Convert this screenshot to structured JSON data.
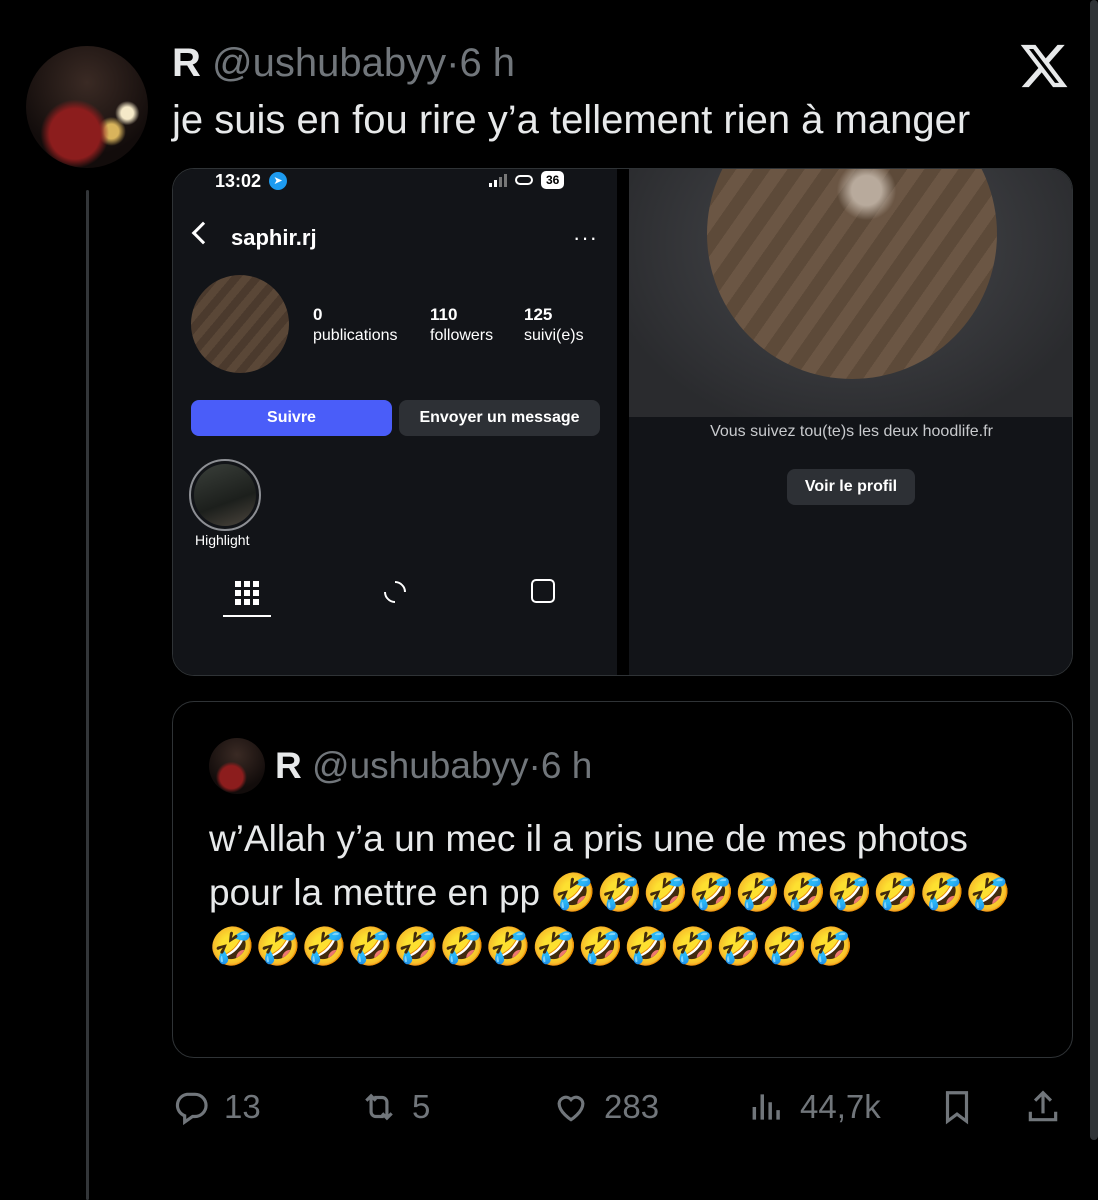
{
  "tweet": {
    "display_name": "R",
    "handle": "@ushubabyy",
    "separator": "·",
    "time": "6 h",
    "text": "je suis en fou rire y’a tellement rien à manger"
  },
  "screenshot_left": {
    "status_time": "13:02",
    "battery": "36",
    "username": "saphir.rj",
    "more": "···",
    "stats": [
      {
        "value": "0",
        "label": "publications"
      },
      {
        "value": "110",
        "label": "followers"
      },
      {
        "value": "125",
        "label": "suivi(e)s"
      }
    ],
    "follow_button": "Suivre",
    "message_button": "Envoyer un message",
    "highlight_label": "Highlight"
  },
  "screenshot_right": {
    "mutual_text": "Vous suivez tou(te)s les deux hoodlife.fr",
    "profile_button": "Voir le profil"
  },
  "quoted_tweet": {
    "display_name": "R",
    "handle": "@ushubabyy",
    "separator": "·",
    "time": "6 h",
    "text": "w’Allah y’a un mec il a pris une de mes photos pour la mettre en pp 🤣🤣🤣🤣🤣🤣🤣🤣🤣🤣🤣🤣🤣🤣🤣🤣🤣🤣🤣🤣🤣🤣🤣🤣"
  },
  "actions": {
    "replies": "13",
    "reposts": "5",
    "likes": "283",
    "views": "44,7k"
  },
  "icons": [
    "x-logo-icon",
    "reply-icon",
    "repost-icon",
    "like-icon",
    "views-icon",
    "bookmark-icon",
    "share-icon"
  ]
}
